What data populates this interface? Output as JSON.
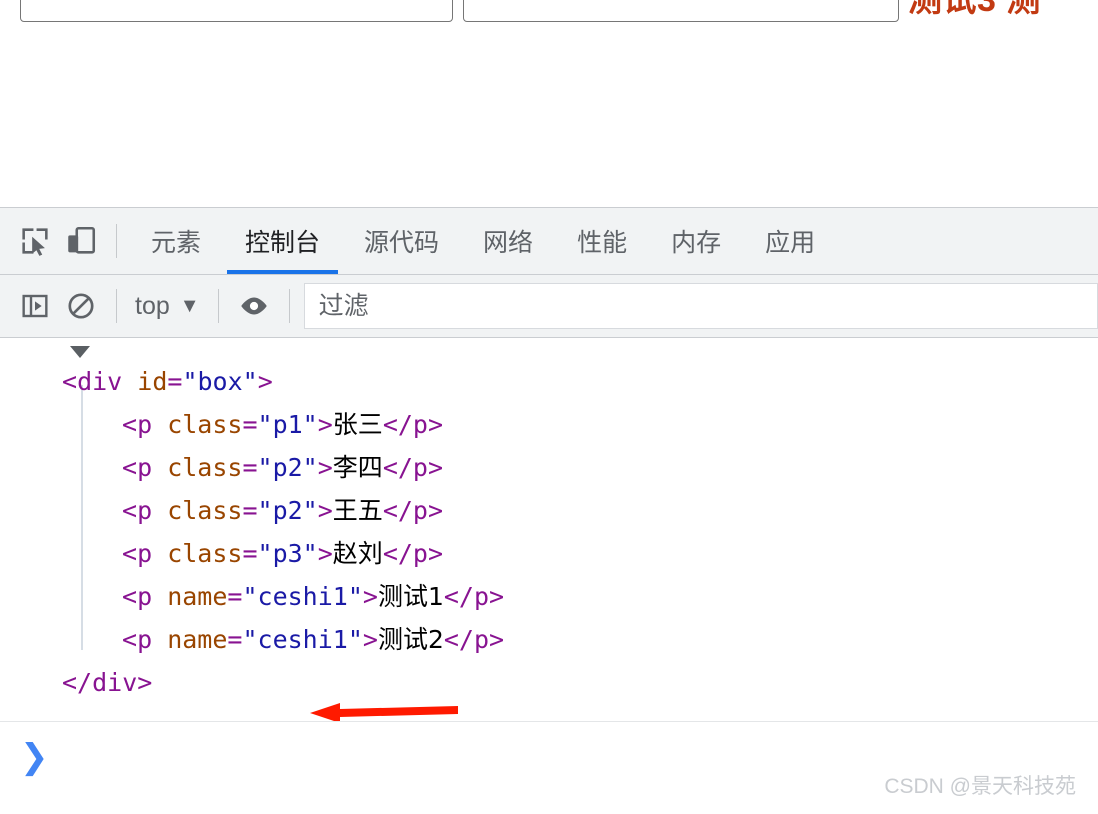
{
  "page": {
    "heading_partial": "测试3 测",
    "inputs": [
      {
        "name": "input-one",
        "value": "",
        "placeholder": ""
      },
      {
        "name": "input-two",
        "value": "",
        "placeholder": ""
      }
    ]
  },
  "devtools": {
    "toolbar_icons": [
      {
        "name": "inspect-element-icon",
        "title": "选择页面元素"
      },
      {
        "name": "device-toolbar-icon",
        "title": "切换设备工具栏"
      }
    ],
    "tabs": [
      {
        "label": "元素",
        "active": false
      },
      {
        "label": "控制台",
        "active": true
      },
      {
        "label": "源代码",
        "active": false
      },
      {
        "label": "网络",
        "active": false
      },
      {
        "label": "性能",
        "active": false
      },
      {
        "label": "内存",
        "active": false
      },
      {
        "label": "应用",
        "active": false
      }
    ],
    "active_tab_underline_color": "#1a73e8",
    "console_toolbar": {
      "sidebar_toggle_icon": "console-sidebar-icon",
      "clear_console_icon": "clear-console-icon",
      "context_label": "top",
      "context_caret": "▼",
      "eye_icon": "live-expression-eye-icon",
      "filter": {
        "value": "",
        "placeholder": "过滤"
      }
    },
    "console_output": {
      "disclosure_expanded": true,
      "lines": [
        {
          "indent": 0,
          "tokens": [
            {
              "t": "punct",
              "s": "<"
            },
            {
              "t": "tag",
              "s": "div"
            },
            {
              "t": "plain",
              "s": " "
            },
            {
              "t": "attr",
              "s": "id"
            },
            {
              "t": "punct",
              "s": "="
            },
            {
              "t": "val",
              "s": "\"box\""
            },
            {
              "t": "punct",
              "s": ">"
            }
          ]
        },
        {
          "indent": 1,
          "tokens": [
            {
              "t": "punct",
              "s": "<"
            },
            {
              "t": "tag",
              "s": "p"
            },
            {
              "t": "plain",
              "s": " "
            },
            {
              "t": "attr",
              "s": "class"
            },
            {
              "t": "punct",
              "s": "="
            },
            {
              "t": "val",
              "s": "\"p1\""
            },
            {
              "t": "punct",
              "s": ">"
            },
            {
              "t": "text",
              "s": "张三"
            },
            {
              "t": "punct",
              "s": "</"
            },
            {
              "t": "tag",
              "s": "p"
            },
            {
              "t": "punct",
              "s": ">"
            }
          ]
        },
        {
          "indent": 1,
          "tokens": [
            {
              "t": "punct",
              "s": "<"
            },
            {
              "t": "tag",
              "s": "p"
            },
            {
              "t": "plain",
              "s": " "
            },
            {
              "t": "attr",
              "s": "class"
            },
            {
              "t": "punct",
              "s": "="
            },
            {
              "t": "val",
              "s": "\"p2\""
            },
            {
              "t": "punct",
              "s": ">"
            },
            {
              "t": "text",
              "s": "李四"
            },
            {
              "t": "punct",
              "s": "</"
            },
            {
              "t": "tag",
              "s": "p"
            },
            {
              "t": "punct",
              "s": ">"
            }
          ]
        },
        {
          "indent": 1,
          "tokens": [
            {
              "t": "punct",
              "s": "<"
            },
            {
              "t": "tag",
              "s": "p"
            },
            {
              "t": "plain",
              "s": " "
            },
            {
              "t": "attr",
              "s": "class"
            },
            {
              "t": "punct",
              "s": "="
            },
            {
              "t": "val",
              "s": "\"p2\""
            },
            {
              "t": "punct",
              "s": ">"
            },
            {
              "t": "text",
              "s": "王五"
            },
            {
              "t": "punct",
              "s": "</"
            },
            {
              "t": "tag",
              "s": "p"
            },
            {
              "t": "punct",
              "s": ">"
            }
          ]
        },
        {
          "indent": 1,
          "tokens": [
            {
              "t": "punct",
              "s": "<"
            },
            {
              "t": "tag",
              "s": "p"
            },
            {
              "t": "plain",
              "s": " "
            },
            {
              "t": "attr",
              "s": "class"
            },
            {
              "t": "punct",
              "s": "="
            },
            {
              "t": "val",
              "s": "\"p3\""
            },
            {
              "t": "punct",
              "s": ">"
            },
            {
              "t": "text",
              "s": "赵刘"
            },
            {
              "t": "punct",
              "s": "</"
            },
            {
              "t": "tag",
              "s": "p"
            },
            {
              "t": "punct",
              "s": ">"
            }
          ]
        },
        {
          "indent": 1,
          "tokens": [
            {
              "t": "punct",
              "s": "<"
            },
            {
              "t": "tag",
              "s": "p"
            },
            {
              "t": "plain",
              "s": " "
            },
            {
              "t": "attr",
              "s": "name"
            },
            {
              "t": "punct",
              "s": "="
            },
            {
              "t": "val",
              "s": "\"ceshi1\""
            },
            {
              "t": "punct",
              "s": ">"
            },
            {
              "t": "text",
              "s": "测试1"
            },
            {
              "t": "punct",
              "s": "</"
            },
            {
              "t": "tag",
              "s": "p"
            },
            {
              "t": "punct",
              "s": ">"
            }
          ]
        },
        {
          "indent": 1,
          "tokens": [
            {
              "t": "punct",
              "s": "<"
            },
            {
              "t": "tag",
              "s": "p"
            },
            {
              "t": "plain",
              "s": " "
            },
            {
              "t": "attr",
              "s": "name"
            },
            {
              "t": "punct",
              "s": "="
            },
            {
              "t": "val",
              "s": "\"ceshi1\""
            },
            {
              "t": "punct",
              "s": ">"
            },
            {
              "t": "text",
              "s": "测试2"
            },
            {
              "t": "punct",
              "s": "</"
            },
            {
              "t": "tag",
              "s": "p"
            },
            {
              "t": "punct",
              "s": ">"
            }
          ]
        },
        {
          "indent": 0,
          "tokens": [
            {
              "t": "punct",
              "s": "</"
            },
            {
              "t": "tag",
              "s": "div"
            },
            {
              "t": "punct",
              "s": ">"
            }
          ]
        }
      ]
    },
    "annotation": {
      "name": "red-arrow",
      "color": "#ff1a00",
      "direction": "left"
    },
    "prompt": {
      "chevron": "❯",
      "value": "",
      "placeholder": ""
    }
  },
  "watermark": "CSDN @景天科技苑"
}
